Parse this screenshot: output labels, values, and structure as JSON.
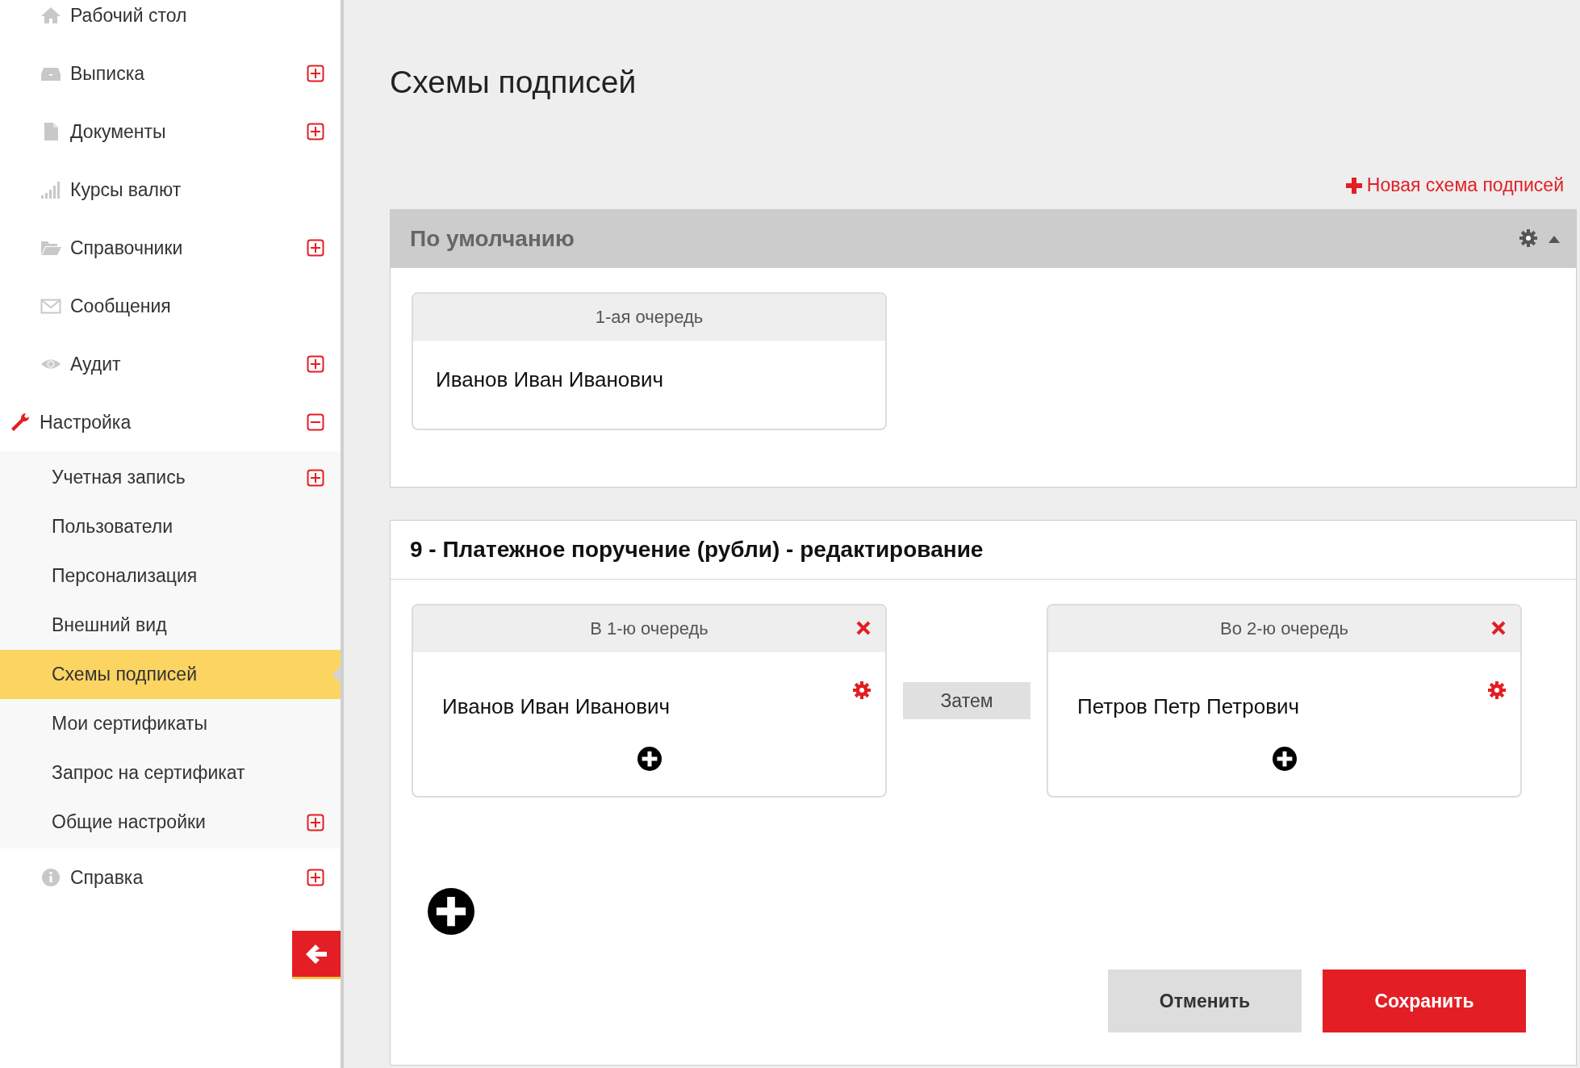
{
  "sidebar": {
    "items": [
      {
        "label": "Рабочий стол",
        "active": false
      },
      {
        "label": "Выписка",
        "active": false,
        "expanded": false
      },
      {
        "label": "Документы",
        "active": false,
        "expanded": false
      },
      {
        "label": "Курсы валют",
        "active": false
      },
      {
        "label": "Справочники",
        "active": false,
        "expanded": false
      },
      {
        "label": "Сообщения",
        "active": false
      },
      {
        "label": "Аудит",
        "active": false,
        "expanded": false
      },
      {
        "label": "Настройка",
        "active": true,
        "expanded": true,
        "children": [
          {
            "label": "Учетная запись",
            "expanded": false,
            "selected": false
          },
          {
            "label": "Пользователи",
            "selected": false
          },
          {
            "label": "Персонализация",
            "selected": false
          },
          {
            "label": "Внешний вид",
            "selected": false
          },
          {
            "label": "Схемы подписей",
            "selected": true
          },
          {
            "label": "Мои сертификаты",
            "selected": false
          },
          {
            "label": "Запрос на сертификат",
            "selected": false
          },
          {
            "label": "Общие настройки",
            "expanded": false,
            "selected": false
          }
        ]
      },
      {
        "label": "Справка",
        "active": false,
        "expanded": false
      }
    ]
  },
  "page": {
    "title": "Схемы подписей",
    "new_link": "Новая схема подписей"
  },
  "schemes": [
    {
      "kind": "default",
      "title": "По умолчанию",
      "queues": [
        {
          "title": "1-ая очередь",
          "signers": [
            "Иванов Иван Иванович"
          ]
        }
      ]
    },
    {
      "kind": "edit",
      "title": "9 - Платежное поручение (рубли) - редактирование",
      "then_label": "Затем",
      "queues": [
        {
          "title": "В 1-ю очередь",
          "signers": [
            "Иванов Иван Иванович"
          ]
        },
        {
          "title": "Во 2-ю очередь",
          "signers": [
            "Петров Петр Петрович"
          ]
        }
      ],
      "actions": [
        {
          "label": "Отменить",
          "kind": "secondary"
        },
        {
          "label": "Сохранить",
          "kind": "primary"
        }
      ]
    }
  ]
}
